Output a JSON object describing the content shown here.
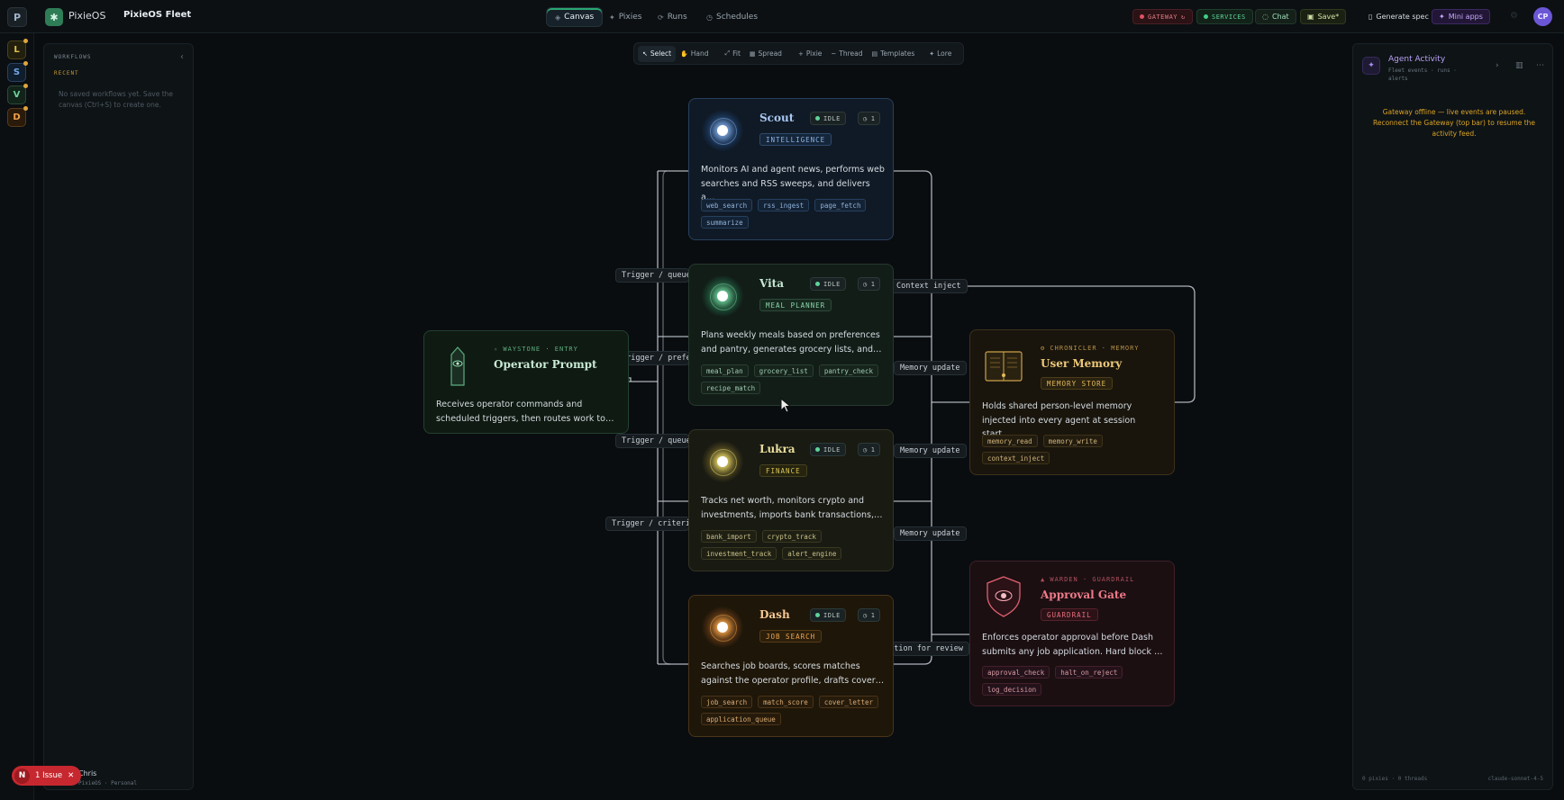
{
  "topbar": {
    "user_initial": "P",
    "app_name": "PixieOS",
    "fleet_name": "PixieOS Fleet",
    "nav": [
      {
        "label": "Canvas",
        "icon": "◈"
      },
      {
        "label": "Pixies",
        "icon": "✦"
      },
      {
        "label": "Runs",
        "icon": "⟳"
      },
      {
        "label": "Schedules",
        "icon": "◷"
      }
    ],
    "gateway_label": "GATEWAY",
    "services_label": "SERVICES",
    "chat_label": "Chat",
    "save_label": "Save*",
    "generate_spec_label": "Generate spec",
    "mini_apps_label": "Mini apps",
    "profile_initials": "CP",
    "colors": {
      "gateway": "#e07a85",
      "services": "#5fd399",
      "accent": "#2aa873"
    }
  },
  "rail": {
    "items": [
      {
        "letter": "L",
        "color": "#e0c04a"
      },
      {
        "letter": "S",
        "color": "#6fa8e8"
      },
      {
        "letter": "V",
        "color": "#6fcf9a"
      },
      {
        "letter": "D",
        "color": "#f0a24a"
      }
    ]
  },
  "workflows": {
    "heading": "WORKFLOWS",
    "recent_label": "RECENT",
    "empty_text": "No saved workflows yet. Save the canvas (Ctrl+S) to create one.",
    "user_name": "Chris",
    "user_org": "PixieOS · Personal"
  },
  "issue": {
    "initial": "N",
    "label": "1 Issue"
  },
  "canvas_toolbar": [
    {
      "label": "Select",
      "icon": "↖"
    },
    {
      "label": "Hand",
      "icon": "✋"
    },
    {
      "label": "Fit",
      "icon": "⤢"
    },
    {
      "label": "Spread",
      "icon": "▦"
    },
    {
      "label": "Pixie",
      "icon": "+"
    },
    {
      "label": "Thread",
      "icon": "~"
    },
    {
      "label": "Templates",
      "icon": "▤"
    },
    {
      "label": "Lore",
      "icon": "✦"
    }
  ],
  "agent_panel": {
    "title": "Agent Activity",
    "subtitle": "Fleet events · runs · alerts",
    "offline_text": "Gateway offline — live events are paused. Reconnect the Gateway (top bar) to resume the activity feed.",
    "footer_left": "0 pixies · 0 threads",
    "footer_right": "claude-sonnet-4-5"
  },
  "edge_labels": {
    "trigger_queue_1": "Trigger / queue",
    "trigger_prefer": "Trigger / preferences",
    "trigger_queue_2": "Trigger / queue",
    "trigger_crite": "Trigger / criteria",
    "context_inject": "Context inject",
    "memory_update_1": "Memory update",
    "memory_update_2": "Memory update",
    "memory_update_3": "Memory update",
    "application_review": "Application for review"
  },
  "nodes": {
    "scout": {
      "name": "Scout",
      "role": "INTELLIGENCE",
      "status": "IDLE",
      "runs": "1",
      "desc": "Monitors AI and agent news, performs web searches and RSS sweeps, and delivers a…",
      "tags": [
        "web_search",
        "rss_ingest",
        "page_fetch",
        "summarize"
      ]
    },
    "vita": {
      "name": "Vita",
      "role": "MEAL PLANNER",
      "status": "IDLE",
      "runs": "1",
      "desc": "Plans weekly meals based on preferences and pantry, generates grocery lists, and…",
      "tags": [
        "meal_plan",
        "grocery_list",
        "pantry_check",
        "recipe_match"
      ]
    },
    "lukra": {
      "name": "Lukra",
      "role": "FINANCE",
      "status": "IDLE",
      "runs": "1",
      "desc": "Tracks net worth, monitors crypto and investments, imports bank transactions,…",
      "tags": [
        "bank_import",
        "crypto_track",
        "investment_track",
        "alert_engine"
      ]
    },
    "dash": {
      "name": "Dash",
      "role": "JOB SEARCH",
      "status": "IDLE",
      "runs": "1",
      "desc": "Searches job boards, scores matches against the operator profile, drafts cover…",
      "tags": [
        "job_search",
        "match_score",
        "cover_letter",
        "application_queue"
      ]
    },
    "operator": {
      "sub": "✧ WAYSTONE · ENTRY",
      "name": "Operator Prompt",
      "desc": "Receives operator commands and scheduled triggers, then routes work to…"
    },
    "memory": {
      "sub": "⚙ CHRONICLER · MEMORY",
      "name": "User Memory",
      "role": "MEMORY STORE",
      "desc": "Holds shared person-level memory injected into every agent at session start.…",
      "tags": [
        "memory_read",
        "memory_write",
        "context_inject"
      ]
    },
    "gate": {
      "sub": "▲ WARDEN · GUARDRAIL",
      "name": "Approval Gate",
      "role": "GUARDRAIL",
      "desc": "Enforces operator approval before Dash submits any job application. Hard block …",
      "tags": [
        "approval_check",
        "halt_on_reject",
        "log_decision"
      ]
    }
  }
}
